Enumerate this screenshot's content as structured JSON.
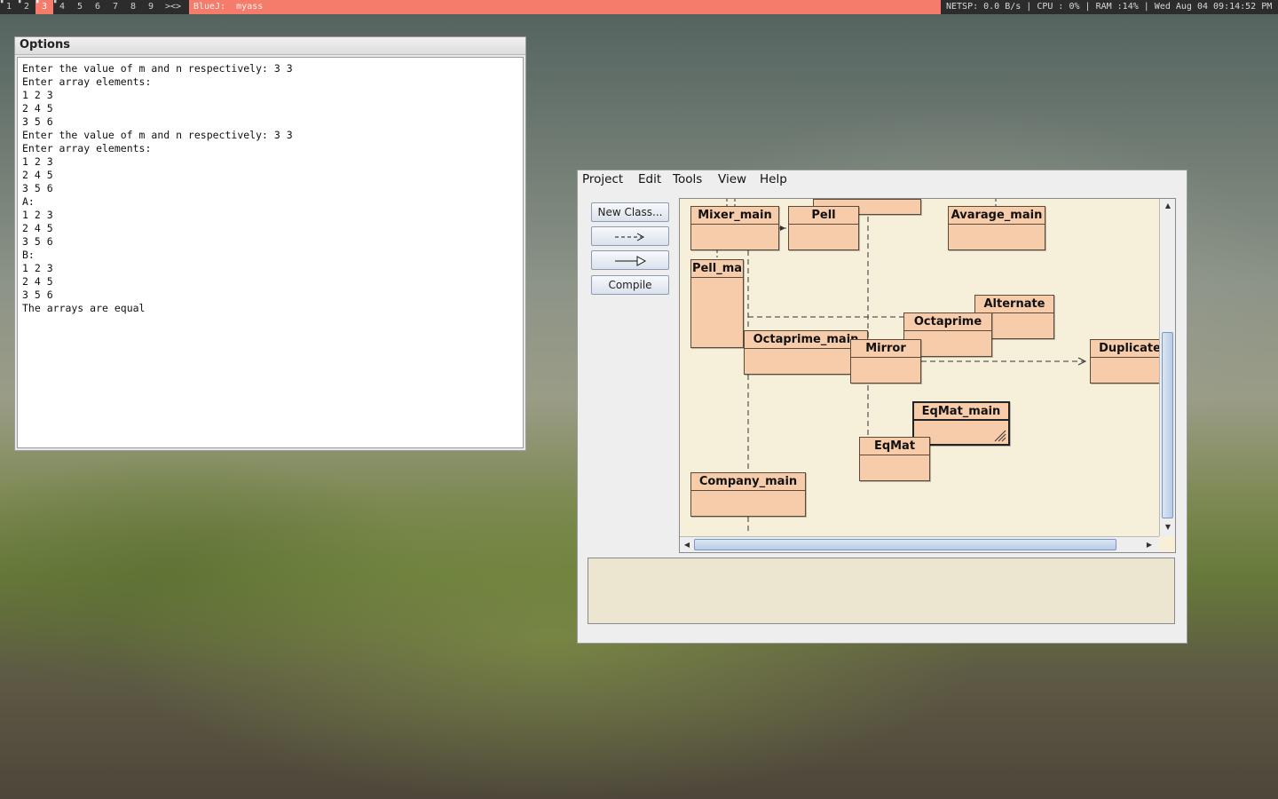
{
  "topbar": {
    "workspaces": [
      "1",
      "2",
      "3",
      "4",
      "5",
      "6",
      "7",
      "8",
      "9"
    ],
    "active_workspace": "3",
    "layout_symbol": "><>",
    "window_title": "BlueJ:  myass",
    "stats": "NETSP: 0.0 B/s | CPU : 0% | RAM :14% | Wed Aug 04 09:14:52 PM",
    "accent_color": "#f57b6b"
  },
  "options_window": {
    "title": "Options",
    "lines": [
      "Enter the value of m and n respectively: 3 3",
      "Enter array elements:",
      "1 2 3",
      "2 4 5",
      "3 5 6",
      "Enter the value of m and n respectively: 3 3",
      "Enter array elements:",
      "1 2 3",
      "2 4 5",
      "3 5 6",
      "A:",
      "1 2 3",
      "2 4 5",
      "3 5 6",
      "B:",
      "1 2 3",
      "2 4 5",
      "3 5 6",
      "The arrays are equal"
    ]
  },
  "bluej": {
    "menu": [
      "Project",
      "Edit",
      "Tools",
      "View",
      "Help"
    ],
    "buttons": {
      "new_class": "New Class...",
      "compile": "Compile"
    },
    "classes": {
      "mixer_main": "Mixer_main",
      "pell": "Pell",
      "avarage_main": "Avarage_main",
      "pell_ma": "Pell_ma",
      "alternate": "Alternate",
      "octaprime": "Octaprime",
      "octaprime_main": "Octaprime_main",
      "mirror": "Mirror",
      "duplicate": "Duplicate",
      "eqmat_main": "EqMat_main",
      "eqmat": "EqMat",
      "company_main": "Company_main"
    },
    "class_fill_color": "#f6ccab",
    "diagram_background": "#f6efd9"
  }
}
